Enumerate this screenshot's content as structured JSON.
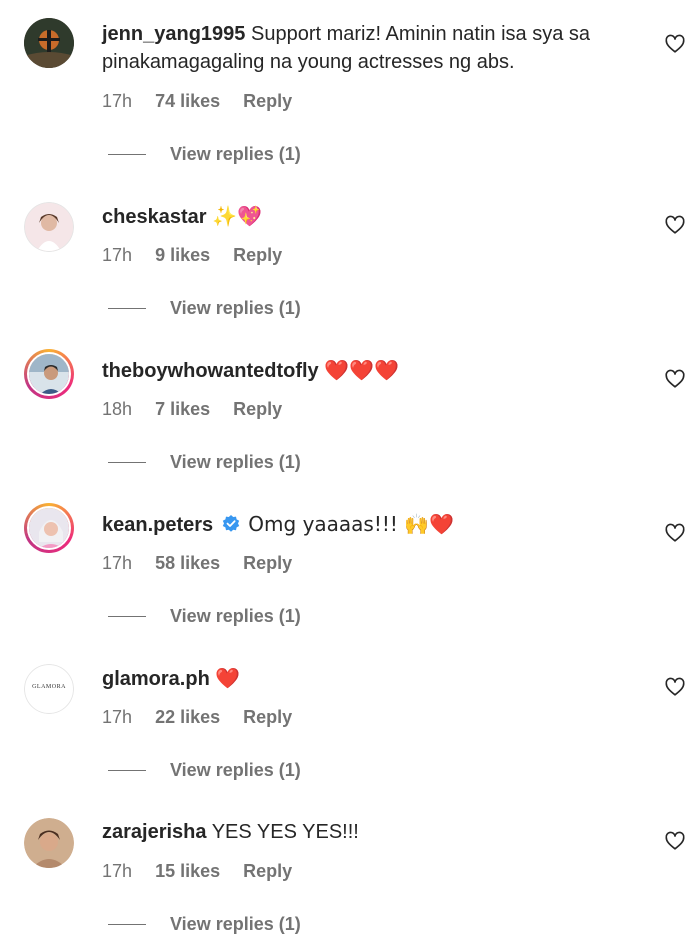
{
  "comments": [
    {
      "username": "jenn_yang1995",
      "text": "Support mariz! Aminin natin isa sya sa pinakamagagaling na young actresses ng abs.",
      "time": "17h",
      "likes": "74 likes",
      "reply": "Reply",
      "view_replies": "View replies (1)"
    },
    {
      "username": "cheskastar",
      "text": "✨💖",
      "time": "17h",
      "likes": "9 likes",
      "reply": "Reply",
      "view_replies": "View replies (1)"
    },
    {
      "username": "theboywhowantedtofly",
      "text": "❤️❤️❤️",
      "time": "18h",
      "likes": "7 likes",
      "reply": "Reply",
      "view_replies": "View replies (1)"
    },
    {
      "username": "kean.peters",
      "text": "Omg yaaaas!!! 🙌❤️",
      "time": "17h",
      "likes": "58 likes",
      "reply": "Reply",
      "view_replies": "View replies (1)"
    },
    {
      "username": "glamora.ph",
      "text": "❤️",
      "time": "17h",
      "likes": "22 likes",
      "reply": "Reply",
      "view_replies": "View replies (1)",
      "avatar_text": "GLAMORA"
    },
    {
      "username": "zarajerisha",
      "text": "YES YES YES!!!",
      "time": "17h",
      "likes": "15 likes",
      "reply": "Reply",
      "view_replies": "View replies (1)"
    }
  ],
  "colors": {
    "verified": "#3897f0",
    "secondary_text": "#737373",
    "primary_text": "#262626"
  },
  "icons": {
    "like": "heart-outline-icon",
    "verified": "verified-badge-icon"
  }
}
